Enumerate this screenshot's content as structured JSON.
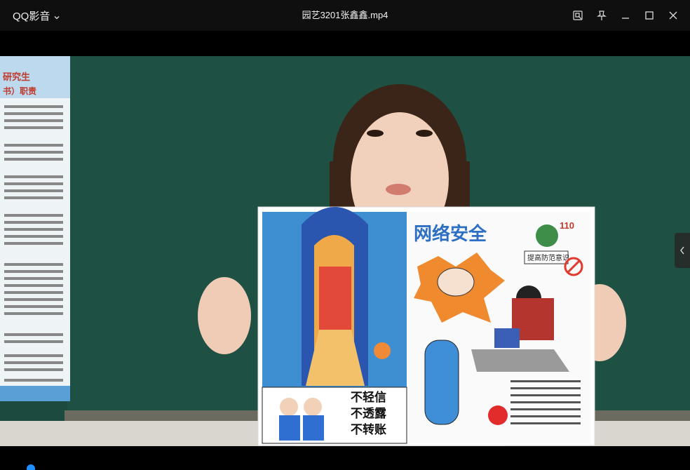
{
  "app": {
    "brand": "QQ影音",
    "file_title": "园艺3201张鑫鑫.mp4"
  },
  "window_controls": [
    {
      "name": "screenshot-icon"
    },
    {
      "name": "pin-icon"
    },
    {
      "name": "minimize-icon"
    },
    {
      "name": "maximize-icon"
    },
    {
      "name": "close-icon"
    }
  ],
  "video": {
    "poster": {
      "title_main": "网络安全",
      "subtitle": "提高防范意识",
      "badge": "110",
      "slogans": [
        "不轻信",
        "不透露",
        "不转账"
      ]
    },
    "board_notice": {
      "heading_1": "研究生",
      "heading_2": "书）职责"
    }
  },
  "playback": {
    "progress": 0.04
  },
  "colors": {
    "accent": "#1d8fff",
    "titlebar": "#0f0f10",
    "board": "#1b4a3e"
  }
}
